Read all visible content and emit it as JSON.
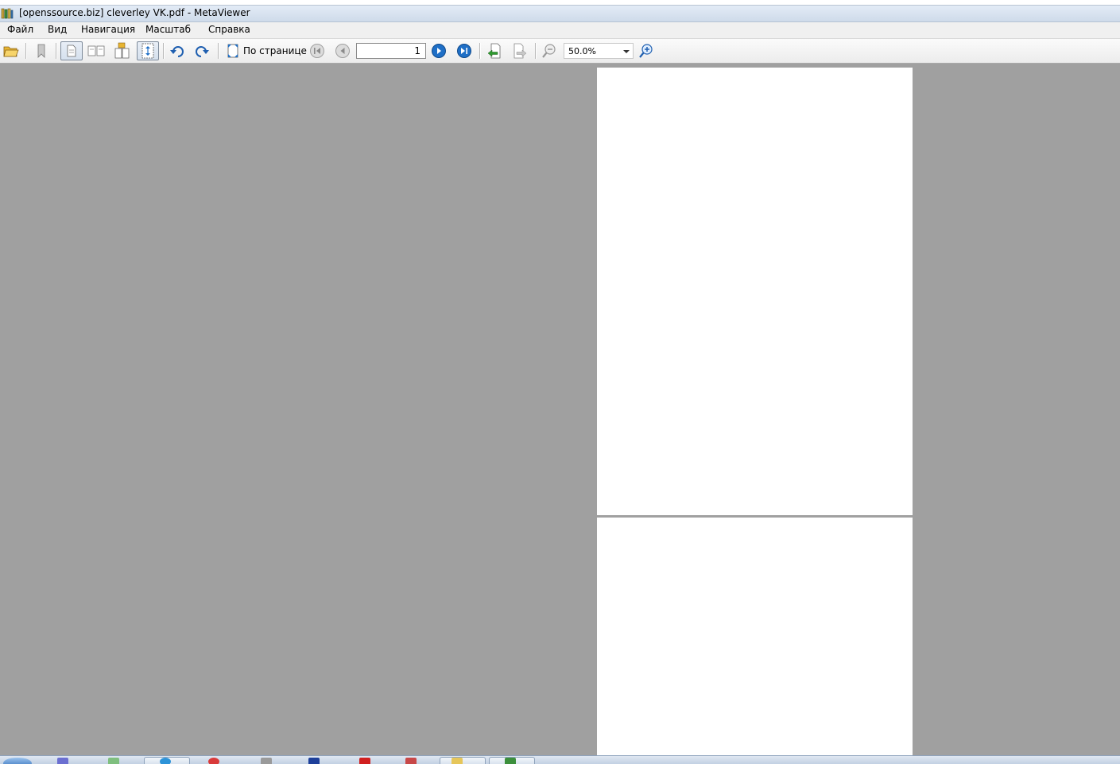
{
  "window": {
    "title": "[openssource.biz] cleverley VK.pdf - MetaViewer"
  },
  "menu": {
    "file": "Файл",
    "view": "Вид",
    "navigation": "Навигация",
    "zoom": "Масштаб",
    "help": "Справка"
  },
  "toolbar": {
    "fit_label": "По странице",
    "page_number": "1",
    "zoom_value": "50.0%"
  },
  "colors": {
    "canvas_bg": "#a0a0a0",
    "page_bg": "#ffffff",
    "nav_blue": "#1f6fc6"
  },
  "taskbar": {
    "icons": [
      "start-orb-icon",
      "app-icon-1",
      "app-icon-2",
      "ie-icon",
      "opera-icon",
      "folder-icon",
      "word-icon",
      "gear-app-icon",
      "mail-icon",
      "explorer-icon",
      "metaviewer-icon"
    ]
  }
}
